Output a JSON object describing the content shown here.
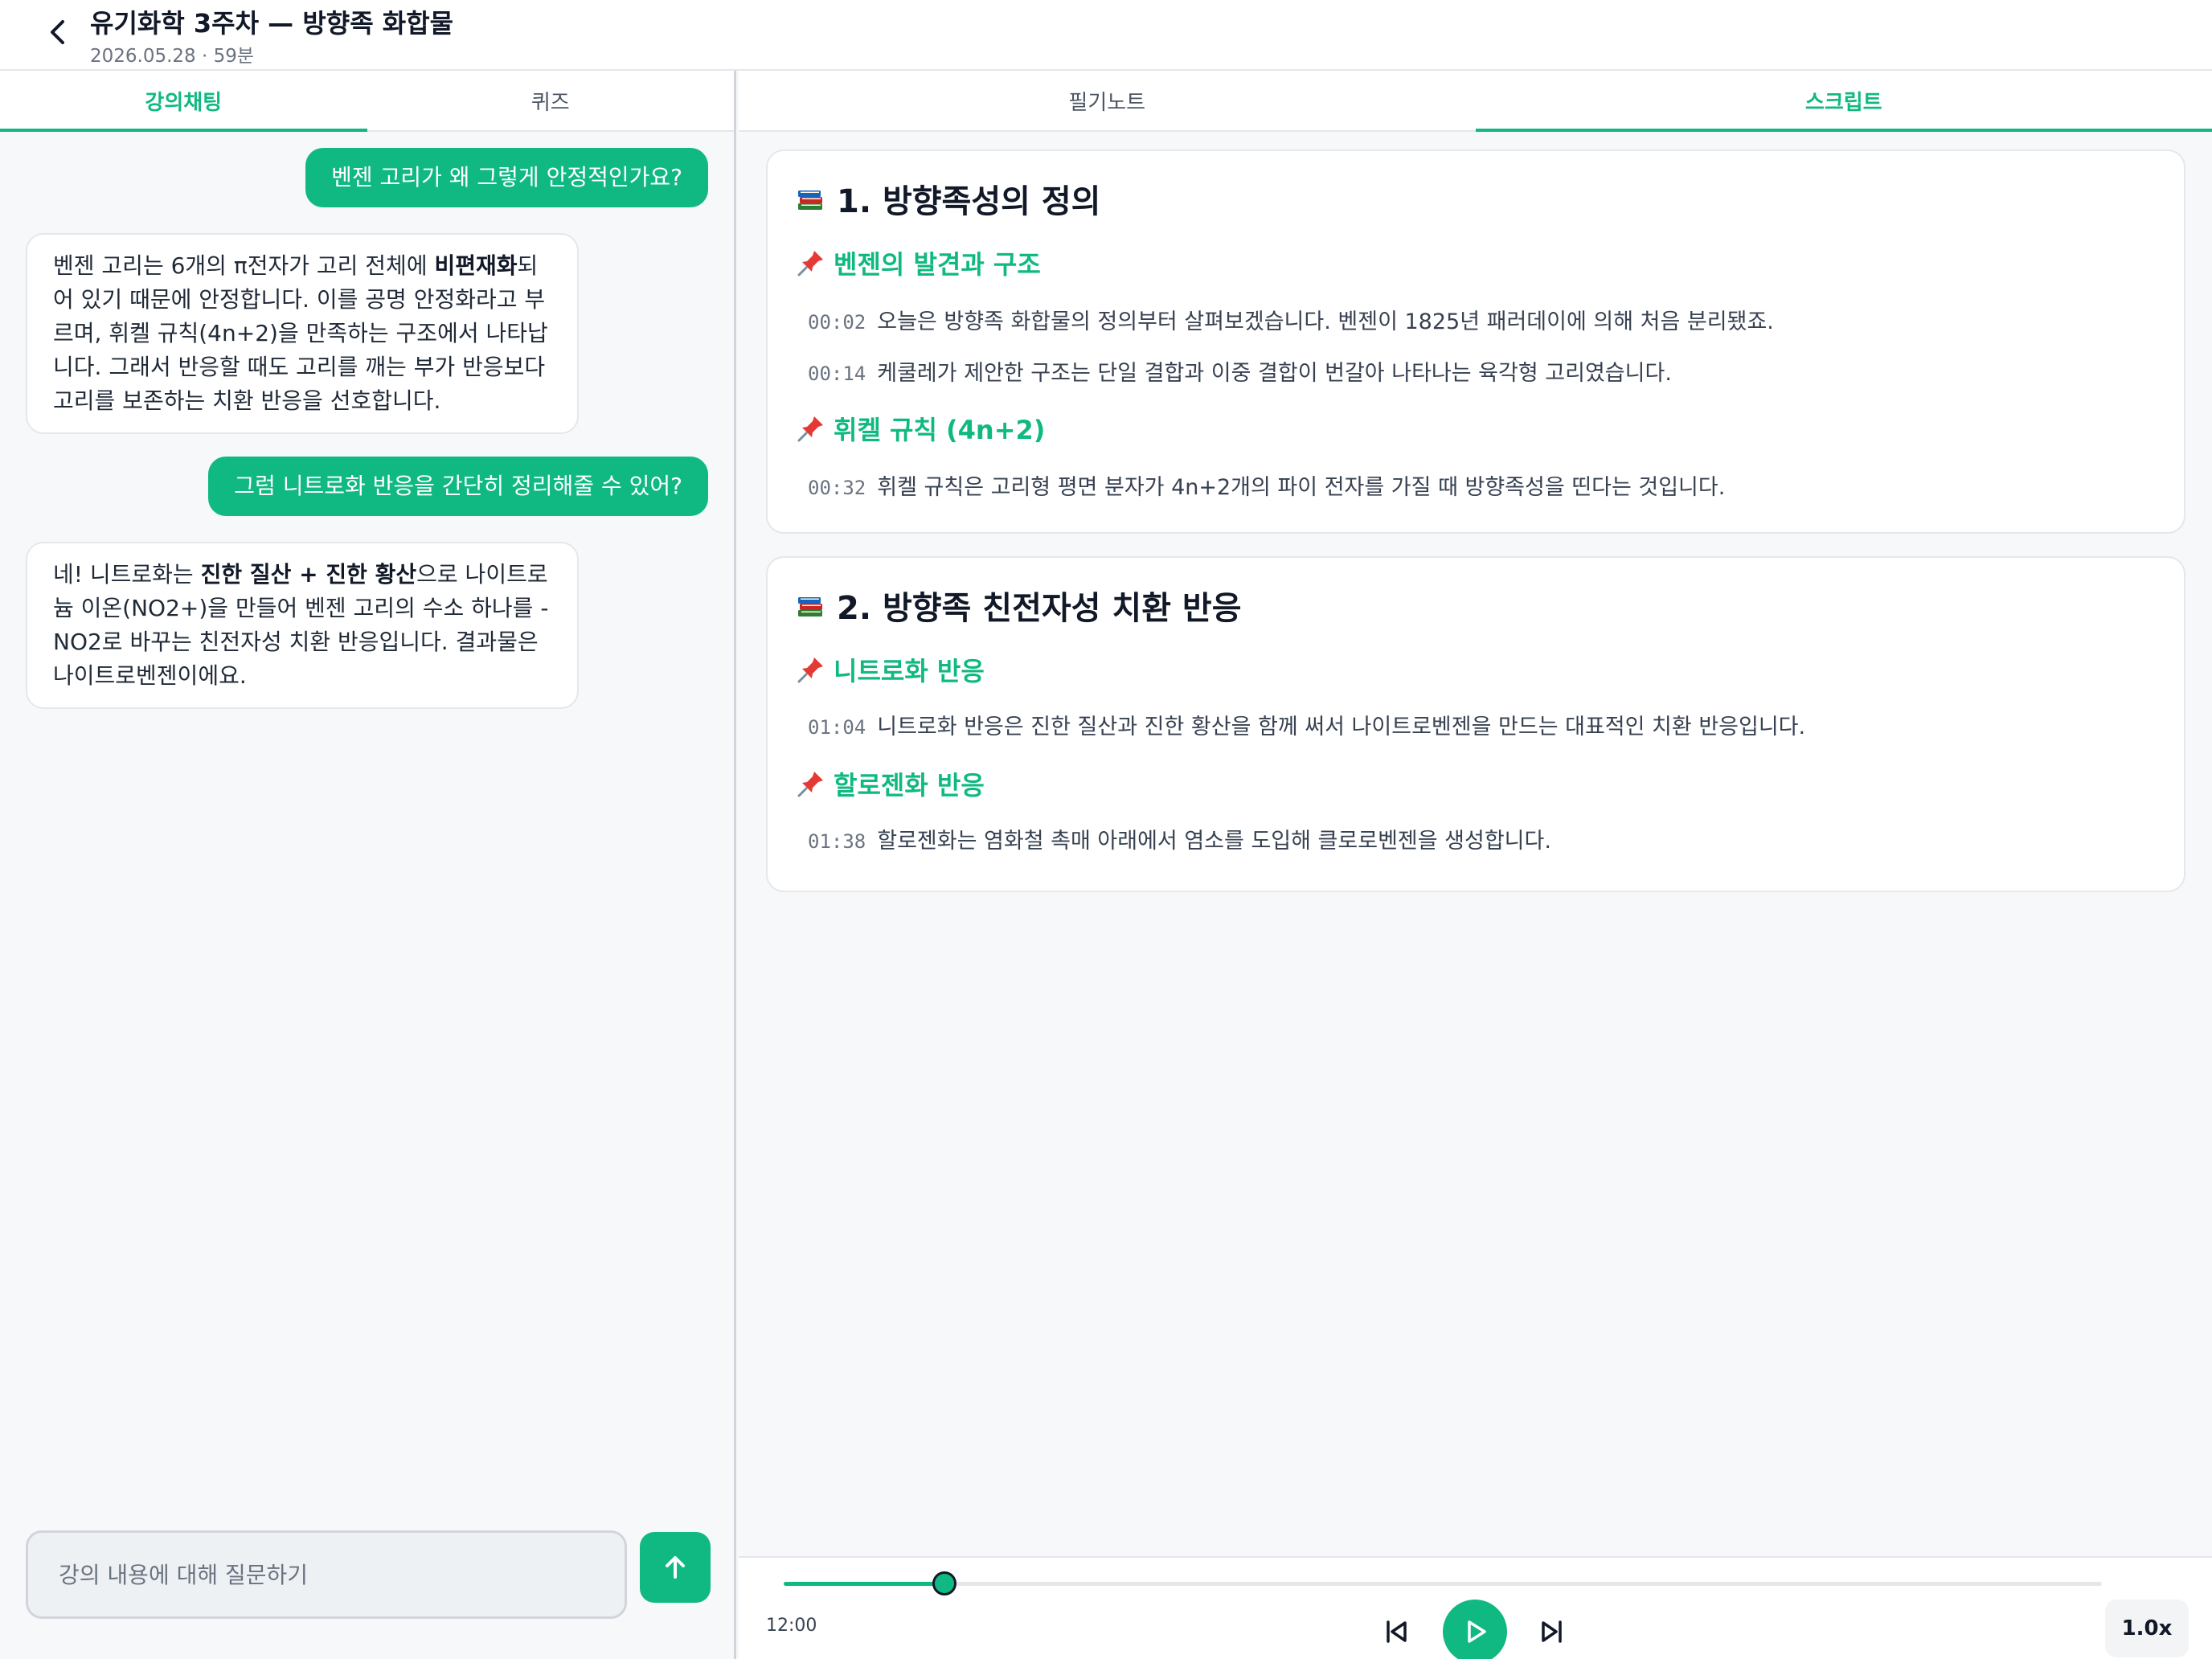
{
  "header": {
    "title": "유기화학 3주차 — 방향족 화합물",
    "meta": "2026.05.28 · 59분"
  },
  "left_tabs": [
    {
      "label": "강의채팅",
      "active": true
    },
    {
      "label": "퀴즈",
      "active": false
    }
  ],
  "right_tabs": [
    {
      "label": "필기노트",
      "active": false
    },
    {
      "label": "스크립트",
      "active": true
    }
  ],
  "chat": {
    "messages": [
      {
        "role": "user",
        "text": "벤젠 고리가 왜 그렇게 안정적인가요?"
      },
      {
        "role": "bot",
        "parts": [
          {
            "t": "벤젠 고리는 6개의 π전자가 고리 전체에 ",
            "b": false
          },
          {
            "t": "비편재화",
            "b": true
          },
          {
            "t": "되어 있기 때문에 안정합니다. 이를 공명 안정화라고 부르며, 휘켈 규칙(4n+2)을 만족하는 구조에서 나타납니다. 그래서 반응할 때도 고리를 깨는 부가 반응보다 고리를 보존하는 치환 반응을 선호합니다.",
            "b": false
          }
        ]
      },
      {
        "role": "user",
        "text": "그럼 니트로화 반응을 간단히 정리해줄 수 있어?"
      },
      {
        "role": "bot",
        "parts": [
          {
            "t": "네! 니트로화는 ",
            "b": false
          },
          {
            "t": "진한 질산 + 진한 황산",
            "b": true
          },
          {
            "t": "으로 나이트로늄 이온(NO2+)을 만들어 벤젠 고리의 수소 하나를 -NO2로 바꾸는 친전자성 치환 반응입니다. 결과물은 나이트로벤젠이에요.",
            "b": false
          }
        ]
      }
    ],
    "input_placeholder": "강의 내용에 대해 질문하기"
  },
  "script": {
    "sections": [
      {
        "title": "1. 방향족성의 정의",
        "subsections": [
          {
            "title": "벤젠의 발견과 구조",
            "lines": [
              {
                "ts": "00:02",
                "text": "오늘은 방향족 화합물의 정의부터 살펴보겠습니다. 벤젠이 1825년 패러데이에 의해 처음 분리됐죠."
              },
              {
                "ts": "00:14",
                "text": "케쿨레가 제안한 구조는 단일 결합과 이중 결합이 번갈아 나타나는 육각형 고리였습니다."
              }
            ]
          },
          {
            "title": "휘켈 규칙 (4n+2)",
            "lines": [
              {
                "ts": "00:32",
                "text": "휘켈 규칙은 고리형 평면 분자가 4n+2개의 파이 전자를 가질 때 방향족성을 띤다는 것입니다."
              }
            ]
          }
        ]
      },
      {
        "title": "2. 방향족 친전자성 치환 반응",
        "subsections": [
          {
            "title": "니트로화 반응",
            "lines": [
              {
                "ts": "01:04",
                "text": "니트로화 반응은 진한 질산과 진한 황산을 함께 써서 나이트로벤젠을 만드는 대표적인 치환 반응입니다."
              }
            ]
          },
          {
            "title": "할로젠화 반응",
            "lines": [
              {
                "ts": "01:38",
                "text": "할로젠화는 염화철 촉매 아래에서 염소를 도입해 클로로벤젠을 생성합니다."
              }
            ]
          }
        ]
      }
    ]
  },
  "player": {
    "current_time": "12:00",
    "progress": 0.122,
    "speed": "1.0x"
  },
  "colors": {
    "accent": "#10b981",
    "text": "#1f2937",
    "muted": "#6b7280"
  },
  "icons": {
    "back": "chevron-left-icon",
    "section": "books-icon",
    "subsection": "pushpin-icon",
    "send": "arrow-up-icon",
    "prev": "skip-back-icon",
    "play": "play-icon",
    "next": "skip-forward-icon"
  }
}
